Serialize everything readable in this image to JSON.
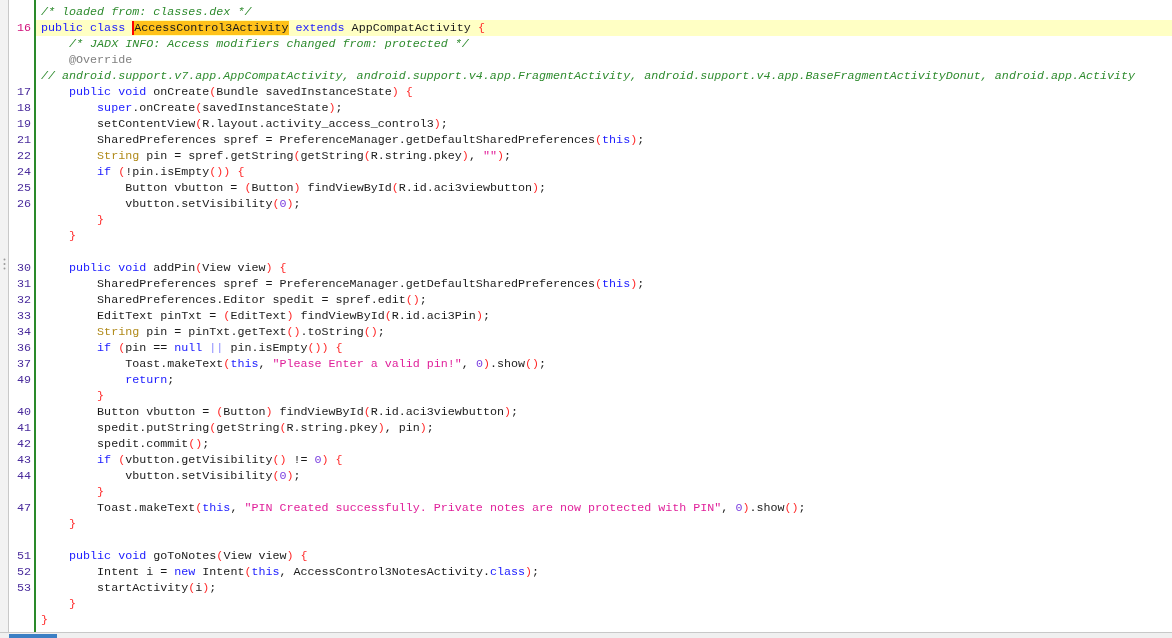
{
  "editor": {
    "lines": [
      {
        "tokens": [
          {
            "kind": "comment",
            "text": "/* loaded from: classes.dex */"
          }
        ],
        "selected": false
      },
      {
        "number": "16",
        "selected": true,
        "tokens": [
          {
            "kind": "keyword",
            "text": "public class "
          },
          {
            "kind": "match",
            "text": "AccessControl3Activity"
          },
          {
            "kind": "keyword",
            "text": " extends"
          },
          {
            "kind": "plain",
            "text": " AppCompatActivity "
          },
          {
            "kind": "brace",
            "text": "{"
          }
        ]
      },
      {
        "selected": false,
        "tokens": [
          {
            "kind": "comment",
            "text": "    /* JADX INFO: Access modifiers changed from: protected */"
          }
        ]
      },
      {
        "selected": false,
        "tokens": [
          {
            "kind": "annotation",
            "text": "    @Override"
          }
        ]
      },
      {
        "selected": false,
        "tokens": [
          {
            "kind": "comment",
            "text": "// android.support.v7.app.AppCompatActivity, android.support.v4.app.FragmentActivity, android.support.v4.app.BaseFragmentActivityDonut, android.app.Activity"
          }
        ]
      },
      {
        "number": "17",
        "selected": false,
        "tokens": [
          {
            "kind": "keyword",
            "text": "    public void"
          },
          {
            "kind": "plain",
            "text": " onCreate"
          },
          {
            "kind": "brace",
            "text": "("
          },
          {
            "kind": "plain",
            "text": "Bundle savedInstanceState"
          },
          {
            "kind": "brace",
            "text": ") {"
          }
        ]
      },
      {
        "number": "18",
        "selected": false,
        "tokens": [
          {
            "kind": "keyword",
            "text": "        super"
          },
          {
            "kind": "plain",
            "text": ".onCreate"
          },
          {
            "kind": "brace",
            "text": "("
          },
          {
            "kind": "plain",
            "text": "savedInstanceState"
          },
          {
            "kind": "brace",
            "text": ")"
          },
          {
            "kind": "plain",
            "text": ";"
          }
        ]
      },
      {
        "number": "19",
        "selected": false,
        "tokens": [
          {
            "kind": "plain",
            "text": "        setContentView"
          },
          {
            "kind": "brace",
            "text": "("
          },
          {
            "kind": "plain",
            "text": "R.layout.activity_access_control3"
          },
          {
            "kind": "brace",
            "text": ")"
          },
          {
            "kind": "plain",
            "text": ";"
          }
        ]
      },
      {
        "number": "21",
        "selected": false,
        "tokens": [
          {
            "kind": "plain",
            "text": "        SharedPreferences spref = PreferenceManager.getDefaultSharedPreferences"
          },
          {
            "kind": "brace",
            "text": "("
          },
          {
            "kind": "keyword",
            "text": "this"
          },
          {
            "kind": "brace",
            "text": ")"
          },
          {
            "kind": "plain",
            "text": ";"
          }
        ]
      },
      {
        "number": "22",
        "selected": false,
        "tokens": [
          {
            "kind": "type",
            "text": "        String"
          },
          {
            "kind": "plain",
            "text": " pin = spref.getString"
          },
          {
            "kind": "brace",
            "text": "("
          },
          {
            "kind": "plain",
            "text": "getString"
          },
          {
            "kind": "brace",
            "text": "("
          },
          {
            "kind": "plain",
            "text": "R.string.pkey"
          },
          {
            "kind": "brace",
            "text": ")"
          },
          {
            "kind": "plain",
            "text": ", "
          },
          {
            "kind": "string",
            "text": "\"\""
          },
          {
            "kind": "brace",
            "text": ")"
          },
          {
            "kind": "plain",
            "text": ";"
          }
        ]
      },
      {
        "number": "24",
        "selected": false,
        "tokens": [
          {
            "kind": "keyword",
            "text": "        if"
          },
          {
            "kind": "brace",
            "text": " ("
          },
          {
            "kind": "plain",
            "text": "!pin.isEmpty"
          },
          {
            "kind": "brace",
            "text": "()) {"
          }
        ]
      },
      {
        "number": "25",
        "selected": false,
        "tokens": [
          {
            "kind": "plain",
            "text": "            Button vbutton = "
          },
          {
            "kind": "brace",
            "text": "("
          },
          {
            "kind": "plain",
            "text": "Button"
          },
          {
            "kind": "brace",
            "text": ")"
          },
          {
            "kind": "plain",
            "text": " findViewById"
          },
          {
            "kind": "brace",
            "text": "("
          },
          {
            "kind": "plain",
            "text": "R.id.aci3viewbutton"
          },
          {
            "kind": "brace",
            "text": ")"
          },
          {
            "kind": "plain",
            "text": ";"
          }
        ]
      },
      {
        "number": "26",
        "selected": false,
        "tokens": [
          {
            "kind": "plain",
            "text": "            vbutton.setVisibility"
          },
          {
            "kind": "brace",
            "text": "("
          },
          {
            "kind": "number",
            "text": "0"
          },
          {
            "kind": "brace",
            "text": ")"
          },
          {
            "kind": "plain",
            "text": ";"
          }
        ]
      },
      {
        "selected": false,
        "tokens": [
          {
            "kind": "brace",
            "text": "        }"
          }
        ]
      },
      {
        "selected": false,
        "tokens": [
          {
            "kind": "brace",
            "text": "    }"
          }
        ]
      },
      {
        "selected": false
      },
      {
        "number": "30",
        "selected": false,
        "tokens": [
          {
            "kind": "keyword",
            "text": "    public void"
          },
          {
            "kind": "plain",
            "text": " addPin"
          },
          {
            "kind": "brace",
            "text": "("
          },
          {
            "kind": "plain",
            "text": "View view"
          },
          {
            "kind": "brace",
            "text": ") {"
          }
        ]
      },
      {
        "number": "31",
        "selected": false,
        "tokens": [
          {
            "kind": "plain",
            "text": "        SharedPreferences spref = PreferenceManager.getDefaultSharedPreferences"
          },
          {
            "kind": "brace",
            "text": "("
          },
          {
            "kind": "keyword",
            "text": "this"
          },
          {
            "kind": "brace",
            "text": ")"
          },
          {
            "kind": "plain",
            "text": ";"
          }
        ]
      },
      {
        "number": "32",
        "selected": false,
        "tokens": [
          {
            "kind": "plain",
            "text": "        SharedPreferences.Editor spedit = spref.edit"
          },
          {
            "kind": "brace",
            "text": "()"
          },
          {
            "kind": "plain",
            "text": ";"
          }
        ]
      },
      {
        "number": "33",
        "selected": false,
        "tokens": [
          {
            "kind": "plain",
            "text": "        EditText pinTxt = "
          },
          {
            "kind": "brace",
            "text": "("
          },
          {
            "kind": "plain",
            "text": "EditText"
          },
          {
            "kind": "brace",
            "text": ")"
          },
          {
            "kind": "plain",
            "text": " findViewById"
          },
          {
            "kind": "brace",
            "text": "("
          },
          {
            "kind": "plain",
            "text": "R.id.aci3Pin"
          },
          {
            "kind": "brace",
            "text": ")"
          },
          {
            "kind": "plain",
            "text": ";"
          }
        ]
      },
      {
        "number": "34",
        "selected": false,
        "tokens": [
          {
            "kind": "type",
            "text": "        String"
          },
          {
            "kind": "plain",
            "text": " pin = pinTxt.getText"
          },
          {
            "kind": "brace",
            "text": "()"
          },
          {
            "kind": "plain",
            "text": ".toString"
          },
          {
            "kind": "brace",
            "text": "()"
          },
          {
            "kind": "plain",
            "text": ";"
          }
        ]
      },
      {
        "number": "36",
        "selected": false,
        "tokens": [
          {
            "kind": "keyword",
            "text": "        if"
          },
          {
            "kind": "brace",
            "text": " ("
          },
          {
            "kind": "plain",
            "text": "pin == "
          },
          {
            "kind": "keyword",
            "text": "null"
          },
          {
            "kind": "operator",
            "text": " ||"
          },
          {
            "kind": "plain",
            "text": " pin.isEmpty"
          },
          {
            "kind": "brace",
            "text": "()) {"
          }
        ]
      },
      {
        "number": "37",
        "selected": false,
        "tokens": [
          {
            "kind": "plain",
            "text": "            Toast.makeText"
          },
          {
            "kind": "brace",
            "text": "("
          },
          {
            "kind": "keyword",
            "text": "this"
          },
          {
            "kind": "plain",
            "text": ", "
          },
          {
            "kind": "string",
            "text": "\"Please Enter a valid pin!\""
          },
          {
            "kind": "plain",
            "text": ", "
          },
          {
            "kind": "number",
            "text": "0"
          },
          {
            "kind": "brace",
            "text": ")"
          },
          {
            "kind": "plain",
            "text": ".show"
          },
          {
            "kind": "brace",
            "text": "()"
          },
          {
            "kind": "plain",
            "text": ";"
          }
        ]
      },
      {
        "number": "49",
        "selected": false,
        "tokens": [
          {
            "kind": "keyword",
            "text": "            return"
          },
          {
            "kind": "plain",
            "text": ";"
          }
        ]
      },
      {
        "selected": false,
        "tokens": [
          {
            "kind": "brace",
            "text": "        }"
          }
        ]
      },
      {
        "number": "40",
        "selected": false,
        "tokens": [
          {
            "kind": "plain",
            "text": "        Button vbutton = "
          },
          {
            "kind": "brace",
            "text": "("
          },
          {
            "kind": "plain",
            "text": "Button"
          },
          {
            "kind": "brace",
            "text": ")"
          },
          {
            "kind": "plain",
            "text": " findViewById"
          },
          {
            "kind": "brace",
            "text": "("
          },
          {
            "kind": "plain",
            "text": "R.id.aci3viewbutton"
          },
          {
            "kind": "brace",
            "text": ")"
          },
          {
            "kind": "plain",
            "text": ";"
          }
        ]
      },
      {
        "number": "41",
        "selected": false,
        "tokens": [
          {
            "kind": "plain",
            "text": "        spedit.putString"
          },
          {
            "kind": "brace",
            "text": "("
          },
          {
            "kind": "plain",
            "text": "getString"
          },
          {
            "kind": "brace",
            "text": "("
          },
          {
            "kind": "plain",
            "text": "R.string.pkey"
          },
          {
            "kind": "brace",
            "text": ")"
          },
          {
            "kind": "plain",
            "text": ", pin"
          },
          {
            "kind": "brace",
            "text": ")"
          },
          {
            "kind": "plain",
            "text": ";"
          }
        ]
      },
      {
        "number": "42",
        "selected": false,
        "tokens": [
          {
            "kind": "plain",
            "text": "        spedit.commit"
          },
          {
            "kind": "brace",
            "text": "()"
          },
          {
            "kind": "plain",
            "text": ";"
          }
        ]
      },
      {
        "number": "43",
        "selected": false,
        "tokens": [
          {
            "kind": "keyword",
            "text": "        if"
          },
          {
            "kind": "brace",
            "text": " ("
          },
          {
            "kind": "plain",
            "text": "vbutton.getVisibility"
          },
          {
            "kind": "brace",
            "text": "()"
          },
          {
            "kind": "plain",
            "text": " != "
          },
          {
            "kind": "number",
            "text": "0"
          },
          {
            "kind": "brace",
            "text": ") {"
          }
        ]
      },
      {
        "number": "44",
        "selected": false,
        "tokens": [
          {
            "kind": "plain",
            "text": "            vbutton.setVisibility"
          },
          {
            "kind": "brace",
            "text": "("
          },
          {
            "kind": "number",
            "text": "0"
          },
          {
            "kind": "brace",
            "text": ")"
          },
          {
            "kind": "plain",
            "text": ";"
          }
        ]
      },
      {
        "selected": false,
        "tokens": [
          {
            "kind": "brace",
            "text": "        }"
          }
        ]
      },
      {
        "number": "47",
        "selected": false,
        "tokens": [
          {
            "kind": "plain",
            "text": "        Toast.makeText"
          },
          {
            "kind": "brace",
            "text": "("
          },
          {
            "kind": "keyword",
            "text": "this"
          },
          {
            "kind": "plain",
            "text": ", "
          },
          {
            "kind": "string",
            "text": "\"PIN Created successfully. Private notes are now protected with PIN\""
          },
          {
            "kind": "plain",
            "text": ", "
          },
          {
            "kind": "number",
            "text": "0"
          },
          {
            "kind": "brace",
            "text": ")"
          },
          {
            "kind": "plain",
            "text": ".show"
          },
          {
            "kind": "brace",
            "text": "()"
          },
          {
            "kind": "plain",
            "text": ";"
          }
        ]
      },
      {
        "selected": false,
        "tokens": [
          {
            "kind": "brace",
            "text": "    }"
          }
        ]
      },
      {
        "selected": false
      },
      {
        "number": "51",
        "selected": false,
        "tokens": [
          {
            "kind": "keyword",
            "text": "    public void"
          },
          {
            "kind": "plain",
            "text": " goToNotes"
          },
          {
            "kind": "brace",
            "text": "("
          },
          {
            "kind": "plain",
            "text": "View view"
          },
          {
            "kind": "brace",
            "text": ") {"
          }
        ]
      },
      {
        "number": "52",
        "selected": false,
        "tokens": [
          {
            "kind": "plain",
            "text": "        Intent i = "
          },
          {
            "kind": "keyword",
            "text": "new"
          },
          {
            "kind": "plain",
            "text": " Intent"
          },
          {
            "kind": "brace",
            "text": "("
          },
          {
            "kind": "keyword",
            "text": "this"
          },
          {
            "kind": "plain",
            "text": ", AccessControl3NotesActivity."
          },
          {
            "kind": "keyword",
            "text": "class"
          },
          {
            "kind": "brace",
            "text": ")"
          },
          {
            "kind": "plain",
            "text": ";"
          }
        ]
      },
      {
        "number": "53",
        "selected": false,
        "tokens": [
          {
            "kind": "plain",
            "text": "        startActivity"
          },
          {
            "kind": "brace",
            "text": "("
          },
          {
            "kind": "plain",
            "text": "i"
          },
          {
            "kind": "brace",
            "text": ")"
          },
          {
            "kind": "plain",
            "text": ";"
          }
        ]
      },
      {
        "selected": false,
        "tokens": [
          {
            "kind": "brace",
            "text": "    }"
          }
        ]
      },
      {
        "selected": false,
        "tokens": [
          {
            "kind": "brace",
            "text": "}"
          }
        ]
      }
    ]
  }
}
